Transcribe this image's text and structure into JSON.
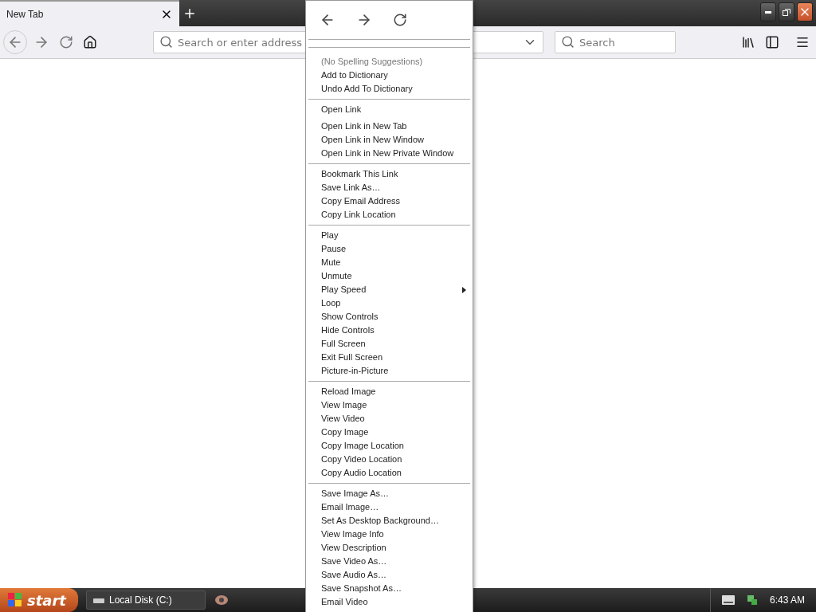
{
  "tabs": [
    {
      "label": "New Tab",
      "selected": true
    }
  ],
  "toolbar": {
    "address_placeholder": "Search or enter address",
    "search_placeholder": "Search"
  },
  "context_menu": {
    "groups": [
      [
        {
          "label": "(No Spelling Suggestions)",
          "disabled": true
        },
        {
          "label": "Add to Dictionary",
          "disabled": false
        },
        {
          "label": "Undo Add To Dictionary",
          "disabled": false
        }
      ],
      [
        {
          "label": "Open Link",
          "disabled": false
        },
        {
          "label": "Open Link in New Tab",
          "disabled": false
        },
        {
          "label": "Open Link in New Window",
          "disabled": false
        },
        {
          "label": "Open Link in New Private Window",
          "disabled": false
        }
      ],
      [
        {
          "label": "Bookmark This Link",
          "disabled": false
        },
        {
          "label": "Save Link As…",
          "disabled": false
        },
        {
          "label": "Copy Email Address",
          "disabled": false
        },
        {
          "label": "Copy Link Location",
          "disabled": false
        }
      ],
      [
        {
          "label": "Play",
          "disabled": false
        },
        {
          "label": "Pause",
          "disabled": false
        },
        {
          "label": "Mute",
          "disabled": false
        },
        {
          "label": "Unmute",
          "disabled": false
        },
        {
          "label": "Play Speed",
          "disabled": false,
          "submenu": true
        },
        {
          "label": "Loop",
          "disabled": false
        },
        {
          "label": "Show Controls",
          "disabled": false
        },
        {
          "label": "Hide Controls",
          "disabled": false
        },
        {
          "label": "Full Screen",
          "disabled": false
        },
        {
          "label": "Exit Full Screen",
          "disabled": false
        },
        {
          "label": "Picture-in-Picture",
          "disabled": false
        }
      ],
      [
        {
          "label": "Reload Image",
          "disabled": false
        },
        {
          "label": "View Image",
          "disabled": false
        },
        {
          "label": "View Video",
          "disabled": false
        },
        {
          "label": "Copy Image",
          "disabled": false
        },
        {
          "label": "Copy Image Location",
          "disabled": false
        },
        {
          "label": "Copy Video Location",
          "disabled": false
        },
        {
          "label": "Copy Audio Location",
          "disabled": false
        }
      ],
      [
        {
          "label": "Save Image As…",
          "disabled": false
        },
        {
          "label": "Email Image…",
          "disabled": false
        },
        {
          "label": "Set As Desktop Background…",
          "disabled": false
        },
        {
          "label": "View Image Info",
          "disabled": false
        },
        {
          "label": "View Description",
          "disabled": false
        },
        {
          "label": "Save Video As…",
          "disabled": false
        },
        {
          "label": "Save Audio As…",
          "disabled": false
        },
        {
          "label": "Save Snapshot As…",
          "disabled": false
        },
        {
          "label": "Email Video",
          "disabled": false
        }
      ]
    ]
  },
  "taskbar": {
    "start": "start",
    "tasks": [
      "Local Disk (C:)"
    ],
    "clock": "6:43 AM"
  }
}
